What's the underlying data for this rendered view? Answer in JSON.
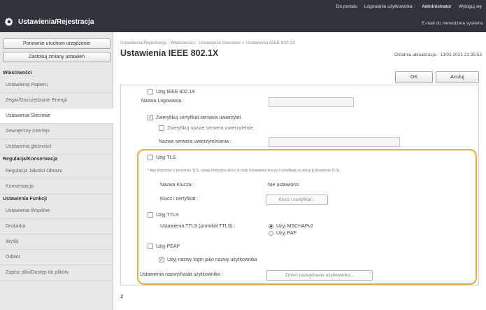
{
  "header": {
    "app_title": "Ustawienia/Rejestracja",
    "links": [
      "Do portalu",
      "Logowanie użytkownika :",
      "Administrator",
      "Wyloguj się"
    ],
    "mail_link": "E-mail do menedżera systemu"
  },
  "sidebar": {
    "top_buttons": [
      "Ponownie uruchom urządzenie",
      "Zastosuj zmiany ustawień"
    ],
    "sections": [
      {
        "title": "Właściwości",
        "items": [
          "Ustawienia Papieru",
          "Zegar/Oszczędzanie Energii",
          "Ustawienia Sieciowe",
          "Zewnętrzny Interfejs",
          "Ustawienia głośności"
        ]
      },
      {
        "title": "Regulacja/Konserwacja",
        "items": [
          "Regulacja Jakości Obrazu",
          "Konserwacja"
        ]
      },
      {
        "title": "Ustawienia Funkcji",
        "items": [
          "Ustawienia Wspólne",
          "Drukarka",
          "Wyślij",
          "Odbiór",
          "Zapisz pliki/Dostęp do plików"
        ]
      }
    ],
    "selected_item": "Ustawienia Sieciowe"
  },
  "main": {
    "breadcrumb": "Ustawienia/Rejestracja : Właściwości : Ustawienia Sieciowe > Ustawienia IEEE 802.1X",
    "title": "Ustawienia IEEE 802.1X",
    "last_updated": "Ostatnia aktualizacja : 13/03 2021 21:35:53",
    "ok_label": "OK",
    "cancel_label": "Anuluj",
    "form": {
      "use_ieee": "Użyj IEEE 802.1X",
      "login_name_label": "Nazwa Logowania :",
      "verify_cert": "Zweryfikuj certyfikat serwera uwierzytel.",
      "verify_name": "Zweryfikuj nazwę serwera uwierzytelnie.",
      "server_name_label": "Nazwa serwera uwierzytelniania :",
      "use_tls": "Użyj TLS",
      "tls_note": "* Aby korzystać z protokołu TLS, ustaw domyślny klucz w opcji Ustawienia kluczy i certyfikatu w sekcji [Ustawienia TLS].",
      "key_name_label": "Nazwa Klucza :",
      "key_name_value": "Nie ustawiono.",
      "key_cert_label": "Klucz i certyfikat :",
      "key_cert_button": "Klucz i certyfikat...",
      "use_ttls": "Użyj TTLS",
      "ttls_settings_label": "Ustawienia TTLS (protokół TTLS) :",
      "ttls_options": [
        "Użyj MSCHAPv2",
        "Użyj PAP"
      ],
      "ttls_selected": "Użyj MSCHAPv2",
      "use_peap": "Użyj PEAP",
      "use_login_as_user": "Użyj nazwy login jako nazwy użytkownika",
      "user_name_settings_label": "Ustawienia nazwy/hasła użytkownika :",
      "change_user_button": "Zmień nazwę/hasło użytkownika...",
      "checked": [
        "Zweryfikuj certyfikat serwera uwierzytel.",
        "Użyj nazwy login jako nazwy użytkownika"
      ]
    },
    "marker": "z"
  },
  "colors": {
    "header_bg": "#2f333a",
    "sidebar_bg": "#e8e8e8",
    "highlight": "#f1a83a"
  }
}
